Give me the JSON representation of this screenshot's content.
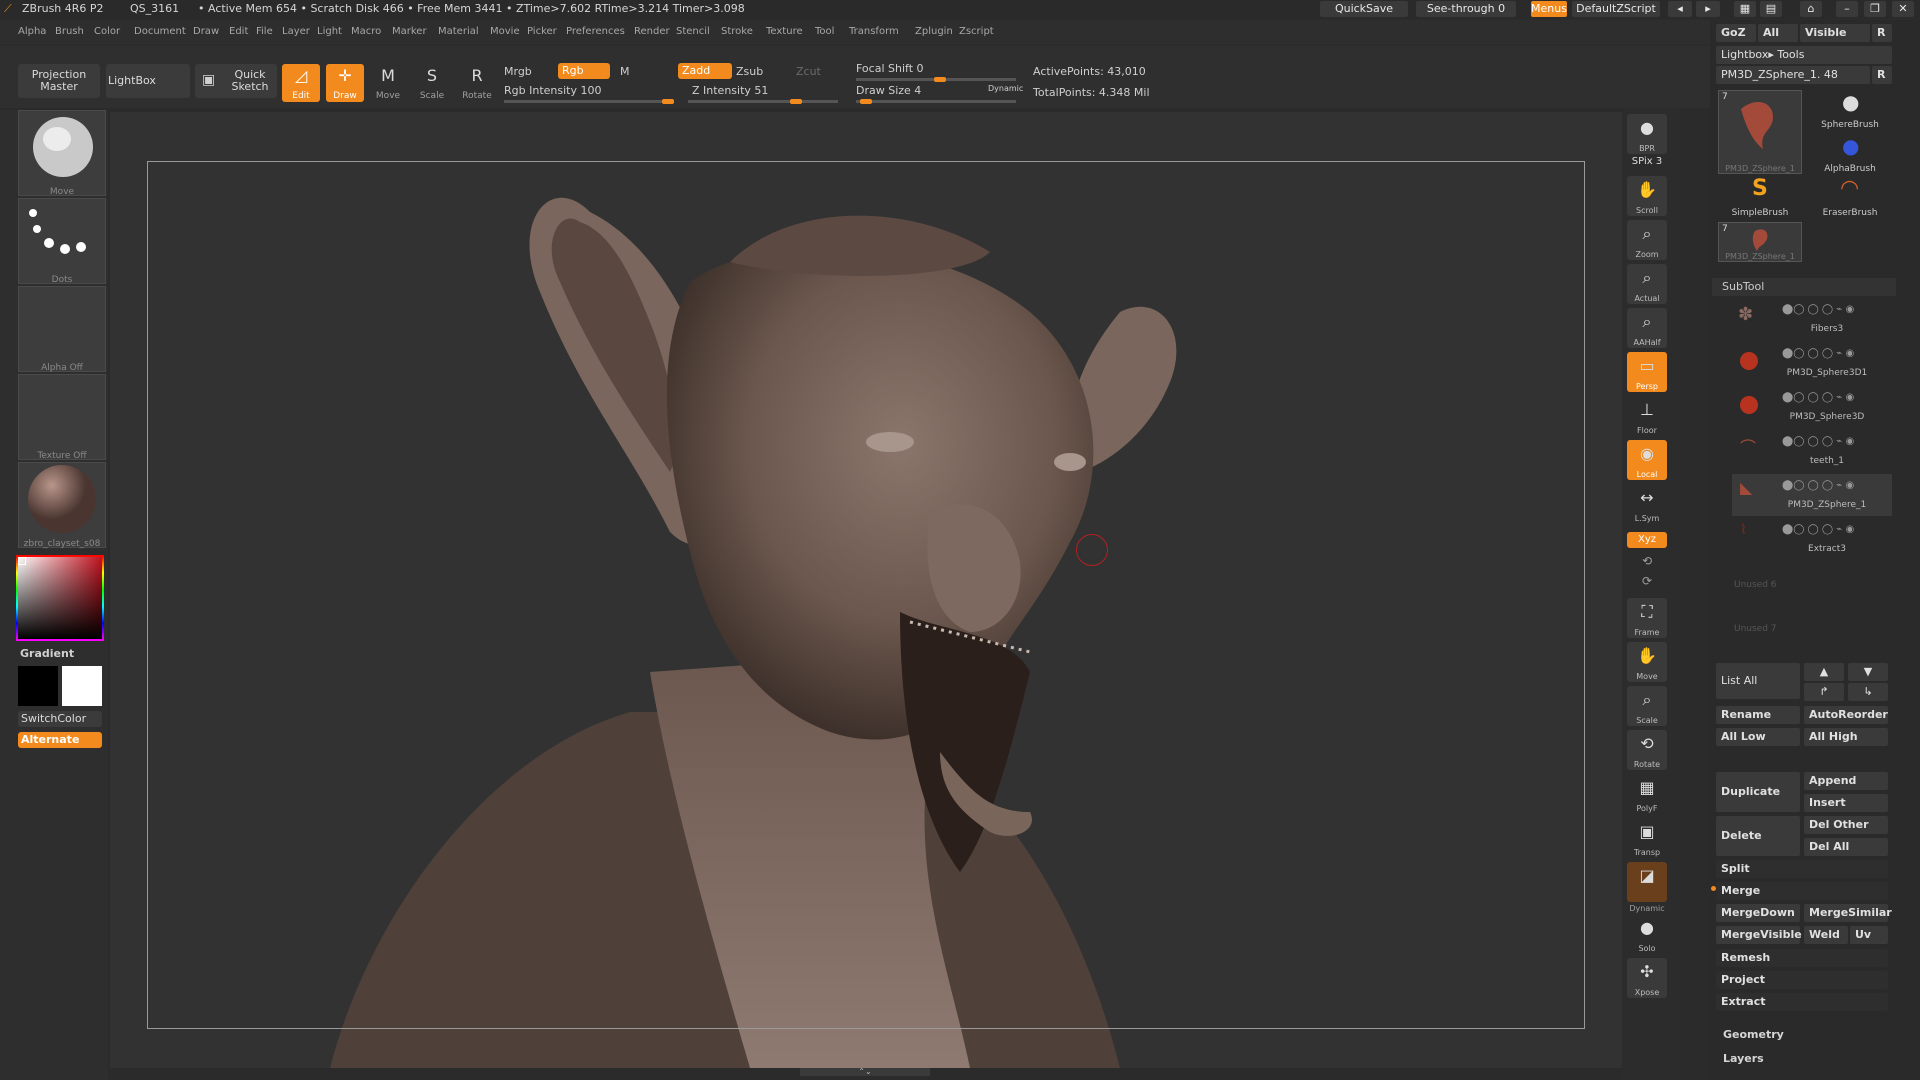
{
  "titlebar": {
    "app": "ZBrush 4R6 P2",
    "project": "QS_3161",
    "stats": "• Active Mem 654 • Scratch Disk 466 • Free Mem 3441 • ZTime>7.602 RTime>3.214 Timer>3.098",
    "quicksave": "QuickSave",
    "seethrough": "See-through  0",
    "menus": "Menus",
    "script": "DefaultZScript"
  },
  "menu": [
    "Alpha",
    "Brush",
    "Color",
    "Document",
    "Draw",
    "Edit",
    "File",
    "Layer",
    "Light",
    "Macro",
    "Marker",
    "Material",
    "Movie",
    "Picker",
    "Preferences",
    "Render",
    "Stencil",
    "Stroke",
    "Texture",
    "Tool",
    "Transform",
    "Zplugin",
    "Zscript"
  ],
  "shelf": {
    "projection_master": "Projection Master",
    "lightbox": "LightBox",
    "quick_sketch": "Quick Sketch",
    "edit": "Edit",
    "draw": "Draw",
    "move": "Move",
    "scale": "Scale",
    "rotate": "Rotate",
    "mrgb": "Mrgb",
    "rgb": "Rgb",
    "m": "M",
    "rgb_intensity": "Rgb Intensity 100",
    "zadd": "Zadd",
    "zsub": "Zsub",
    "zcut": "Zcut",
    "z_intensity": "Z Intensity 51",
    "focal_shift": "Focal Shift 0",
    "draw_size": "Draw Size 4",
    "dynamic": "Dynamic",
    "active_points": "ActivePoints: 43,010",
    "total_points": "TotalPoints: 4.348 Mil",
    "focal_shift_value": 0,
    "rgb_intensity_value": 100,
    "z_intensity_value": 51
  },
  "left": {
    "brush_cap": "Move",
    "stroke_cap": "Dots",
    "alpha_cap": "Alpha Off",
    "texture_cap": "Texture Off",
    "material_cap": "zbro_clayset_s08",
    "gradient": "Gradient",
    "switchcolor": "SwitchColor",
    "alternate": "Alternate"
  },
  "rtools": {
    "bpr": "BPR",
    "spix": "SPix 3",
    "scroll": "Scroll",
    "zoom": "Zoom",
    "actual": "Actual",
    "aahalf": "AAHalf",
    "persp": "Persp",
    "floor": "Floor",
    "local": "Local",
    "lsym": "L.Sym",
    "xyz": "Xyz",
    "frame": "Frame",
    "move": "Move",
    "scale": "Scale",
    "rotate": "Rotate",
    "polyf": "PolyF",
    "transp": "Transp",
    "dynamic": "Dynamic",
    "solo": "Solo",
    "xpose": "Xpose"
  },
  "rpanel": {
    "goz": "GoZ",
    "all": "All",
    "visible": "Visible",
    "r": "R",
    "lightbox_tools": "Lightbox▸ Tools",
    "current_tool": "PM3D_ZSphere_1. 48",
    "tool_thumb_num": "7",
    "tool_thumb_cap": "PM3D_ZSphere_1",
    "sphere_brush": "SphereBrush",
    "alpha_brush": "AlphaBrush",
    "simple_brush": "SimpleBrush",
    "eraser_brush": "EraserBrush",
    "tool2_num": "7",
    "tool2_cap": "PM3D_ZSphere_1",
    "subtool_title": "SubTool",
    "subtools": [
      "Fibers3",
      "PM3D_Sphere3D1",
      "PM3D_Sphere3D",
      "teeth_1",
      "PM3D_ZSphere_1",
      "Extract3"
    ],
    "unused6": "Unused 6",
    "unused7": "Unused 7",
    "list_all": "List  All",
    "rename": "Rename",
    "autoreorder": "AutoReorder",
    "all_low": "All  Low",
    "all_high": "All  High",
    "duplicate": "Duplicate",
    "append": "Append",
    "insert": "Insert",
    "delete": "Delete",
    "del_other": "Del  Other",
    "del_all": "Del  All",
    "split": "Split",
    "merge": "Merge",
    "mergedown": "MergeDown",
    "mergesimilar": "MergeSimilar",
    "mergevisible": "MergeVisible",
    "weld": "Weld",
    "uv": "Uv",
    "remesh": "Remesh",
    "project": "Project",
    "extract": "Extract",
    "geometry": "Geometry",
    "layers": "Layers"
  },
  "colors": {
    "accent": "#f28a1e",
    "sculpt": "#6e5a50",
    "background": "#323232"
  }
}
